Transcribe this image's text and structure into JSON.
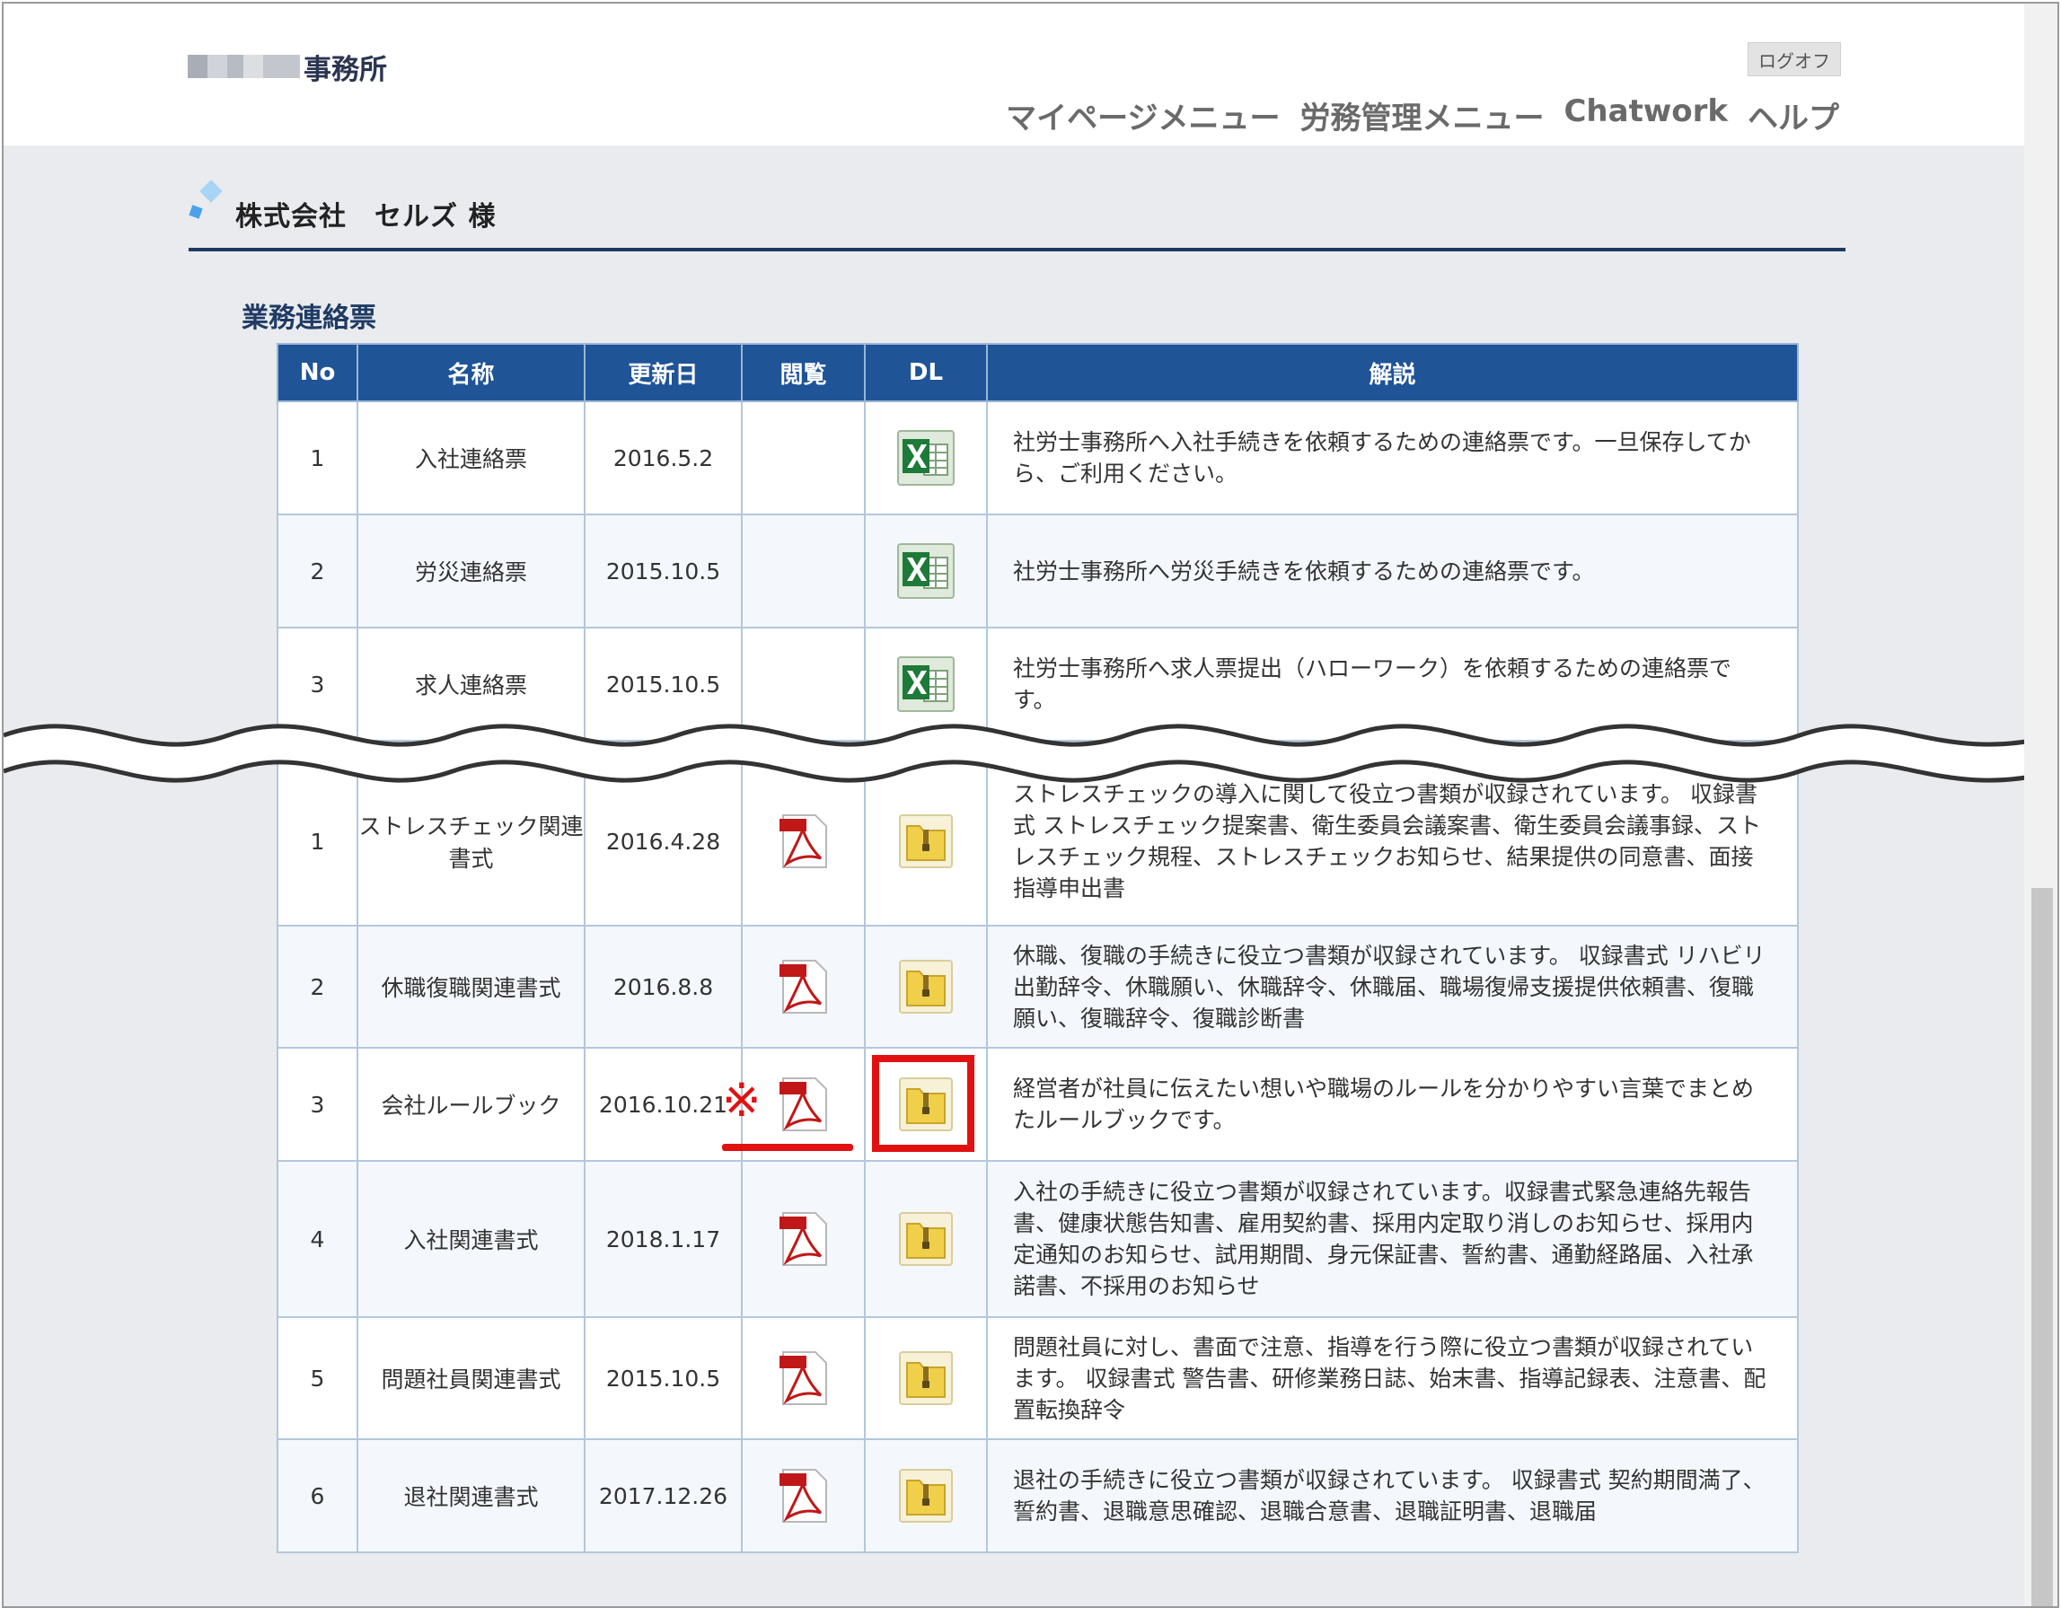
{
  "header": {
    "office_name": "事務所",
    "logoff_label": "ログオフ",
    "nav": [
      "マイページメニュー",
      "労務管理メニュー",
      "Chatwork",
      "ヘルプ"
    ]
  },
  "company": {
    "name": "株式会社　セルズ 様"
  },
  "section_title": "業務連絡票",
  "table_headers": [
    "No",
    "名称",
    "更新日",
    "閲覧",
    "DL",
    "解説"
  ],
  "contact_forms": [
    {
      "no": "1",
      "name": "入社連絡票",
      "date": "2016.5.2",
      "dl_icon": "excel-icon",
      "desc": "社労士事務所へ入社手続きを依頼するための連絡票です。一旦保存してから、ご利用ください。"
    },
    {
      "no": "2",
      "name": "労災連絡票",
      "date": "2015.10.5",
      "dl_icon": "excel-icon",
      "desc": "社労士事務所へ労災手続きを依頼するための連絡票です。"
    },
    {
      "no": "3",
      "name": "求人連絡票",
      "date": "2015.10.5",
      "dl_icon": "excel-icon",
      "desc": "社労士事務所へ求人票提出（ハローワーク）を依頼するための連絡票です。"
    }
  ],
  "document_sets": [
    {
      "no": "1",
      "name": "ストレスチェック関連書式",
      "date": "2016.4.28",
      "desc": "ストレスチェックの導入に関して役立つ書類が収録されています。 収録書式 ストレスチェック提案書、衛生委員会議案書、衛生委員会議事録、ストレスチェック規程、ストレスチェックお知らせ、結果提供の同意書、面接指導申出書"
    },
    {
      "no": "2",
      "name": "休職復職関連書式",
      "date": "2016.8.8",
      "desc": "休職、復職の手続きに役立つ書類が収録されています。 収録書式 リハビリ出勤辞令、休職願い、休職辞令、休職届、職場復帰支援提供依頼書、復職願い、復職辞令、復職診断書"
    },
    {
      "no": "3",
      "name": "会社ルールブック",
      "date": "2016.10.21",
      "desc": "経営者が社員に伝えたい想いや職場のルールを分かりやすい言葉でまとめたルールブックです。"
    },
    {
      "no": "4",
      "name": "入社関連書式",
      "date": "2018.1.17",
      "desc": "入社の手続きに役立つ書類が収録されています。収録書式緊急連絡先報告書、健康状態告知書、雇用契約書、採用内定取り消しのお知らせ、採用内定通知のお知らせ、試用期間、身元保証書、誓約書、通勤経路届、入社承諾書、不採用のお知らせ"
    },
    {
      "no": "5",
      "name": "問題社員関連書式",
      "date": "2015.10.5",
      "desc": "問題社員に対し、書面で注意、指導を行う際に役立つ書類が収録されています。 収録書式 警告書、研修業務日誌、始末書、指導記録表、注意書、配置転換辞令"
    },
    {
      "no": "6",
      "name": "退社関連書式",
      "date": "2017.12.26",
      "desc": "退社の手続きに役立つ書類が収録されています。 収録書式 契約期間満了、誓約書、退職意思確認、退職合意書、退職証明書、退職届"
    }
  ],
  "annotation": {
    "mark": "※",
    "color": "#e21111"
  },
  "colors": {
    "header_blue": "#1f5497",
    "navy_rule": "#1f3b64",
    "background": "#e9ebee",
    "highlight": "#e21111"
  }
}
